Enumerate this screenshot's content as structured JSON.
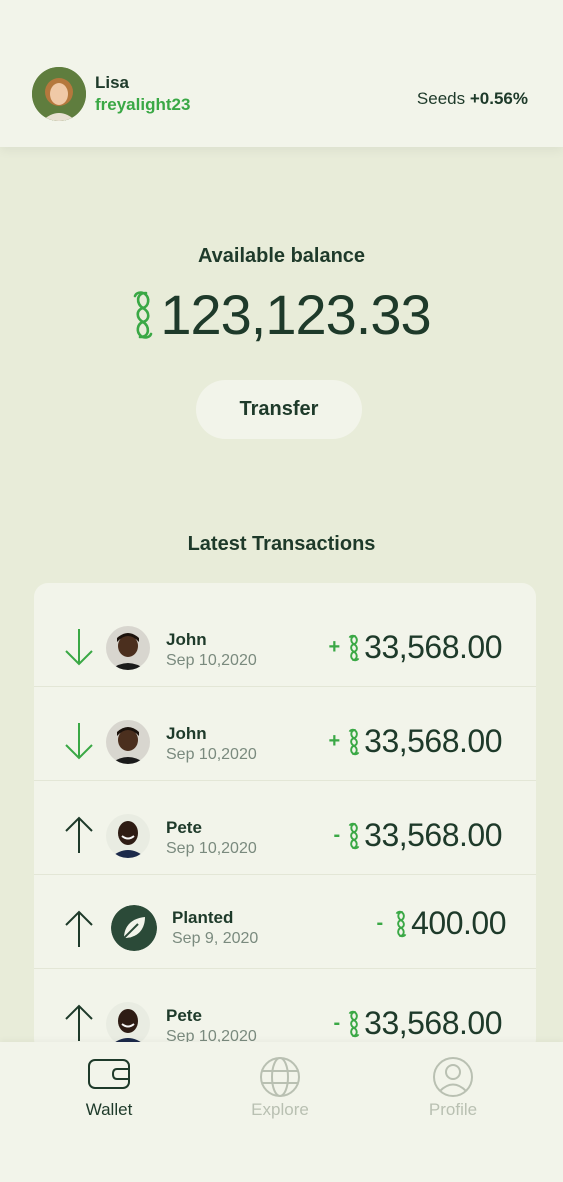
{
  "colors": {
    "accent": "#3aa845",
    "text": "#1e3a2a",
    "background": "#e8ecd9",
    "card": "#f2f4ea",
    "muted": "#7a8a7e"
  },
  "header": {
    "name": "Lisa",
    "handle": "freyalight23",
    "seeds_label": "Seeds",
    "seeds_change": "+0.56%",
    "avatar_icon": "profile-photo"
  },
  "balance": {
    "label": "Available balance",
    "amount": "123,123.33",
    "currency_icon": "seeds-currency-icon"
  },
  "transfer_label": "Transfer",
  "transactions": {
    "title": "Latest Transactions",
    "items": [
      {
        "direction": "incoming",
        "name": "John",
        "date": "Sep 10,2020",
        "sign": "+",
        "amount": "33,568.00"
      },
      {
        "direction": "incoming",
        "name": "John",
        "date": "Sep 10,2020",
        "sign": "+",
        "amount": "33,568.00"
      },
      {
        "direction": "outgoing",
        "name": "Pete",
        "date": "Sep 10,2020",
        "sign": "-",
        "amount": "33,568.00"
      },
      {
        "direction": "outgoing",
        "name": "Planted",
        "date": "Sep 9, 2020",
        "sign": "-",
        "amount": "400.00"
      },
      {
        "direction": "outgoing",
        "name": "Pete",
        "date": "Sep 10,2020",
        "sign": "-",
        "amount": "33,568.00"
      }
    ]
  },
  "tabs": [
    {
      "label": "Wallet",
      "icon": "wallet-icon",
      "active": true
    },
    {
      "label": "Explore",
      "icon": "globe-icon",
      "active": false
    },
    {
      "label": "Profile",
      "icon": "user-icon",
      "active": false
    }
  ]
}
